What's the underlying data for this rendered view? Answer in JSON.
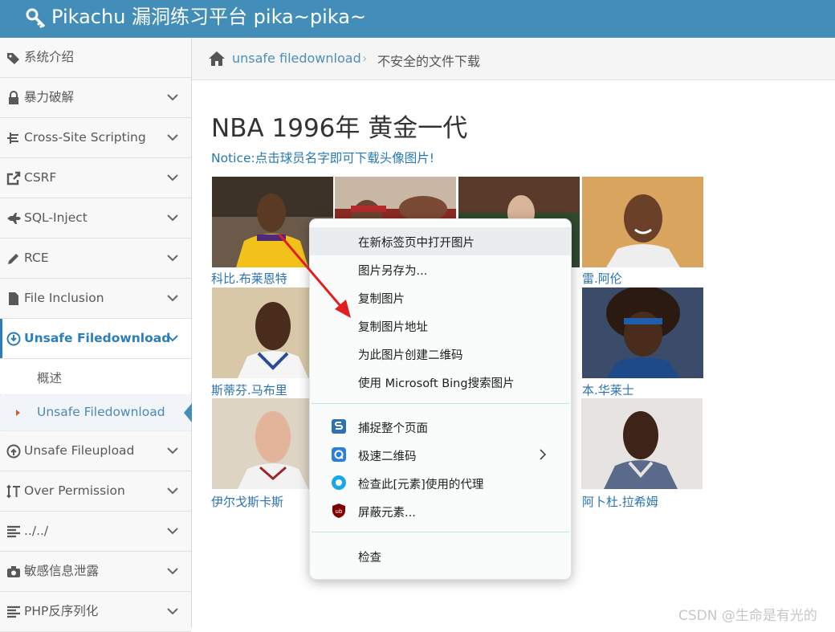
{
  "header": {
    "title": "Pikachu 漏洞练习平台 pika~pika~"
  },
  "sidebar": {
    "items": [
      {
        "label": "系统介绍"
      },
      {
        "label": "暴力破解"
      },
      {
        "label": "Cross-Site Scripting"
      },
      {
        "label": "CSRF"
      },
      {
        "label": "SQL-Inject"
      },
      {
        "label": "RCE"
      },
      {
        "label": "File Inclusion"
      },
      {
        "label": "Unsafe Filedownload"
      },
      {
        "label": "Unsafe Fileupload"
      },
      {
        "label": "Over Permission"
      },
      {
        "label": "../../"
      },
      {
        "label": "敏感信息泄露"
      },
      {
        "label": "PHP反序列化"
      }
    ],
    "subitems": [
      {
        "label": "概述"
      },
      {
        "label": "Unsafe Filedownload"
      }
    ]
  },
  "breadcrumb": {
    "parent": "unsafe filedownload",
    "current": "不安全的文件下载"
  },
  "main": {
    "heading": "NBA 1996年 黄金一代",
    "notice": "Notice:点击球员名字即可下载头像图片!",
    "players": [
      {
        "name": "科比.布莱恩特"
      },
      {
        "name": "雷.阿伦"
      },
      {
        "name": "斯蒂芬.马布里"
      },
      {
        "name": "本.华莱士"
      },
      {
        "name": "伊尔戈斯卡斯"
      },
      {
        "name": "阿卜杜.拉希姆"
      }
    ]
  },
  "context_menu": {
    "group1": [
      {
        "label": "在新标签页中打开图片"
      },
      {
        "label": "图片另存为..."
      },
      {
        "label": "复制图片"
      },
      {
        "label": "复制图片地址"
      },
      {
        "label": "为此图片创建二维码"
      },
      {
        "label": "使用 Microsoft Bing搜索图片"
      }
    ],
    "group2": [
      {
        "label": "捕捉整个页面",
        "icon": "capture-page-icon"
      },
      {
        "label": "极速二维码",
        "icon": "qr-code-extension-icon"
      },
      {
        "label": "检查此[元素]使用的代理",
        "icon": "proxy-extension-icon"
      },
      {
        "label": "屏蔽元素...",
        "icon": "ublock-icon"
      }
    ],
    "group3": [
      {
        "label": "检查"
      }
    ]
  },
  "watermark": "CSDN @生命是有光的",
  "colors": {
    "header": "#438eb9",
    "link": "#2a72b5",
    "active": "#2b7dbc",
    "arrow": "#e02020"
  }
}
